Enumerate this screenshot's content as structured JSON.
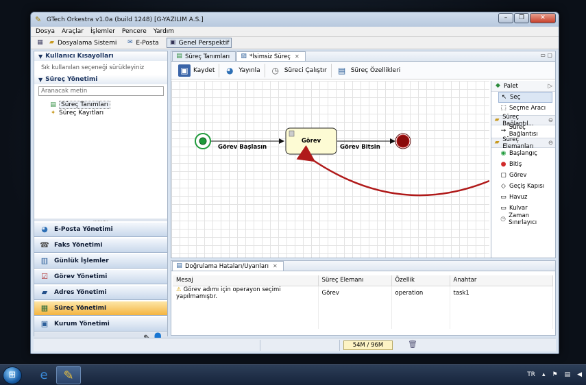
{
  "window": {
    "title": "GTech Orkestra v1.0a (build 1248) [G-YAZILIM A.S.]"
  },
  "menu": [
    "Dosya",
    "Araçlar",
    "İşlemler",
    "Pencere",
    "Yardım"
  ],
  "toolbar": {
    "items": [
      "Dosyalama Sistemi",
      "E-Posta",
      "Genel Perspektif"
    ]
  },
  "left": {
    "shortcuts_title": "Kullanıcı Kısayolları",
    "shortcuts_hint": "Sık kullanılan seçeneği sürükleyiniz",
    "process_title": "Süreç Yönetimi",
    "search_placeholder": "Aranacak metin",
    "tree": [
      "Süreç Tanımları",
      "Süreç Kayıtları"
    ],
    "grip": "..........",
    "nav": [
      "E-Posta Yönetimi",
      "Faks Yönetimi",
      "Günlük İşlemler",
      "Görev Yönetimi",
      "Adres Yönetimi",
      "Süreç Yönetimi",
      "Kurum Yönetimi"
    ],
    "nav_active": 5
  },
  "editor": {
    "tabs": [
      "Süreç Tanımları",
      "*İsimsiz Süreç"
    ],
    "toolbar": [
      "Kaydet",
      "Yayınla",
      "Süreci Çalıştır",
      "Süreç Özellikleri"
    ],
    "diagram": {
      "start_label": "Görev Başlasın",
      "task_label": "Görev",
      "end_label": "Görev Bitsin"
    }
  },
  "palette": {
    "title": "Palet",
    "tools": [
      "Seç",
      "Seçme Aracı"
    ],
    "group_connections": "Süreç Bağlantıl...",
    "connections": [
      "Süreç Bağlantısı"
    ],
    "group_elements": "Süreç Elemanları",
    "elements": [
      "Başlangıç",
      "Bitiş",
      "Görev",
      "Geçiş Kapısı",
      "Havuz",
      "Kulvar",
      "Zaman Sınırlayıcı"
    ]
  },
  "validation": {
    "tab": "Doğrulama Hataları/Uyarıları",
    "columns": [
      "Mesaj",
      "Süreç Elemanı",
      "Özellik",
      "Anahtar"
    ],
    "rows": [
      {
        "message": "Görev adımı için operayon seçimi yapılmamıştır.",
        "element": "Görev",
        "property": "operation",
        "key": "task1"
      }
    ]
  },
  "status": {
    "memory": "54M / 96M"
  },
  "taskbar": {
    "lang": "TR"
  },
  "colors": {
    "accent_orange": "#f4b440",
    "arrow_red": "#b01a1a",
    "start_green": "#1e9a3a",
    "end_red": "#8a0b0b"
  }
}
